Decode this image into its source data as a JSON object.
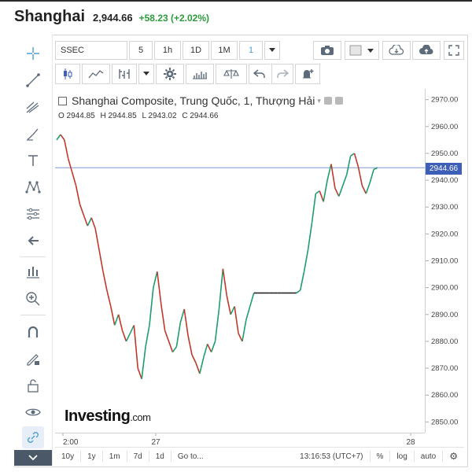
{
  "header": {
    "name": "Shanghai",
    "price": "2,944.66",
    "change": "+58.23 (+2.02%)"
  },
  "toolbar": {
    "symbol": "SSEC",
    "intervals": [
      "5",
      "1h",
      "1D",
      "1M",
      "1"
    ],
    "icons_row1_right": [
      "camera-icon",
      "color-swatch-icon",
      "cloud-download-icon",
      "cloud-upload-icon",
      "fullscreen-icon"
    ],
    "icons_row2": [
      "candles-icon",
      "area-icon",
      "indicators-icon",
      "settings-icon",
      "bars-icon",
      "compare-icon",
      "undo-icon",
      "redo-icon",
      "alert-icon"
    ]
  },
  "left_tools": [
    "crosshair-icon",
    "trend-line-icon",
    "fib-icon",
    "brush-icon",
    "text-icon",
    "pattern-icon",
    "measure-icon",
    "back-arrow-icon",
    "forecast-icon",
    "zoom-icon",
    "magnet-icon",
    "pencil-lock-icon",
    "unlock-icon",
    "eye-icon",
    "link-icon"
  ],
  "legend": {
    "title": "Shanghai Composite, Trung Quốc, 1, Thượng Hải"
  },
  "ohlc": {
    "o": "O 2944.85",
    "h": "H 2944.85",
    "l": "L 2943.02",
    "c": "C 2944.66"
  },
  "bottombar": {
    "ranges": [
      "10y",
      "1y",
      "1m",
      "7d",
      "1d",
      "Go to..."
    ],
    "time": "13:16:53 (UTC+7)",
    "pct": "%",
    "log": "log",
    "auto": "auto"
  },
  "logo": {
    "main": "Investing",
    "suffix": ".com"
  },
  "last_price_tag": "2944.66",
  "chart_data": {
    "type": "line",
    "x_ticks": [
      "2:00",
      "27",
      "28"
    ],
    "y_ticks": [
      2850,
      2860,
      2870,
      2880,
      2890,
      2900,
      2910,
      2920,
      2930,
      2940,
      2950,
      2960,
      2970
    ],
    "ylim": [
      2846,
      2974
    ],
    "current_value": 2944.66,
    "series": [
      {
        "values": [
          2955,
          2957,
          2955,
          2948,
          2943,
          2938,
          2931,
          2927,
          2923,
          2926,
          2922,
          2914,
          2906,
          2899,
          2893,
          2886,
          2890,
          2884,
          2880,
          2883,
          2886,
          2870,
          2866,
          2878,
          2886,
          2900,
          2906,
          2894,
          2884,
          2880,
          2876,
          2878,
          2887,
          2892,
          2882,
          2875,
          2872,
          2868,
          2874,
          2879,
          2876,
          2880,
          2892,
          2907,
          2897,
          2890,
          2893,
          2883,
          2880,
          2888,
          2893,
          2898,
          2898,
          2898,
          2898,
          2898,
          2898,
          2898,
          2898,
          2898,
          2898,
          2898,
          2898,
          2899,
          2906,
          2914,
          2924,
          2935,
          2936,
          2932,
          2940,
          2946,
          2937,
          2934,
          2938,
          2942,
          2949,
          2950,
          2945,
          2938,
          2935,
          2939,
          2944,
          2944.66
        ]
      }
    ]
  }
}
